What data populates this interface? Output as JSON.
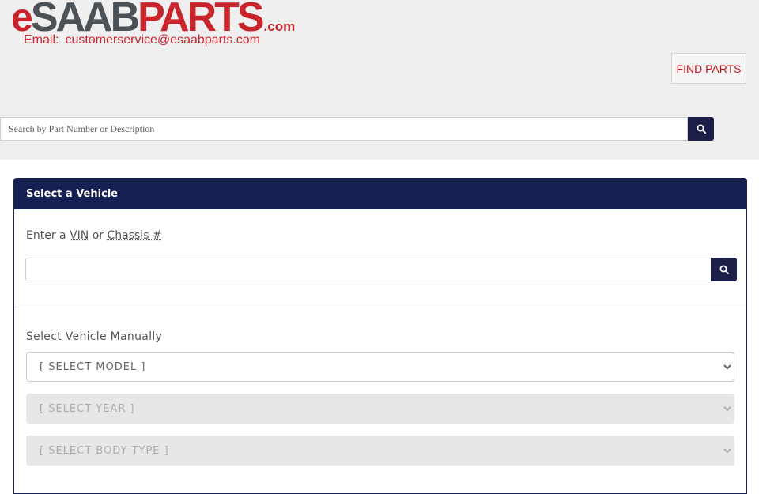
{
  "header": {
    "logo": {
      "e": "e",
      "saab": "SAAB",
      "parts": "PARTS",
      "com": ".com"
    },
    "email_label": "Email:",
    "email_address": "customerservice@esaabparts.com",
    "find_parts_label": "FIND PARTS",
    "search": {
      "placeholder": "Search by Part Number or Description",
      "value": ""
    }
  },
  "vehicle_panel": {
    "title": "Select a Vehicle",
    "vin_prompt": {
      "prefix": "Enter a",
      "vin": "VIN",
      "or": "or",
      "chassis": "Chassis #"
    },
    "vin_input_value": "",
    "manual_label": "Select Vehicle Manually",
    "model_select": "[ SELECT MODEL ]",
    "year_select": "[ SELECT YEAR ]",
    "body_select": "[ SELECT BODY TYPE ]"
  },
  "icons": {
    "search": "search-icon",
    "chevron": "chevron-down-icon"
  },
  "colors": {
    "brand_red": "#c9242b",
    "logo_gray": "#4a5258",
    "navy": "#172052",
    "header_bg": "#efefef"
  }
}
